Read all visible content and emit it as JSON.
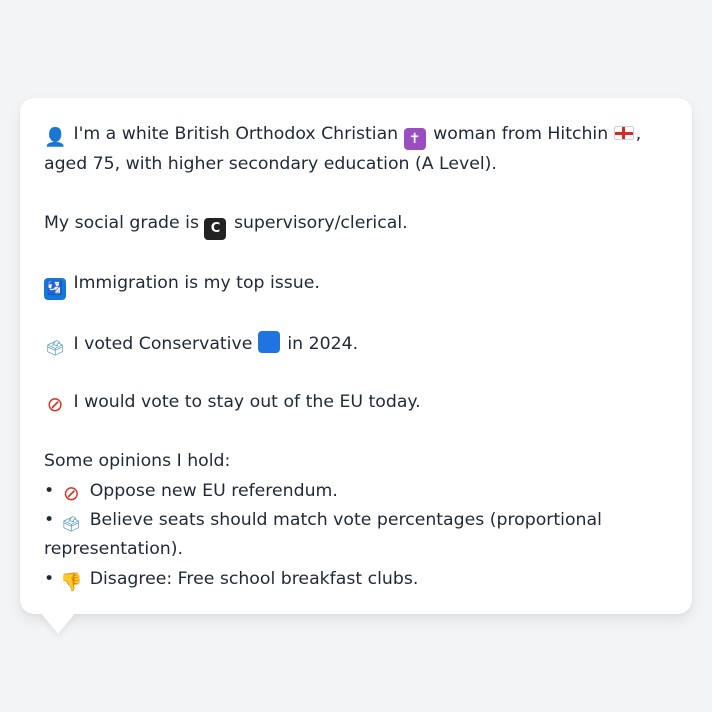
{
  "message": {
    "intro_a": "I'm a white British Orthodox Christian",
    "intro_b": "woman from Hitchin",
    "intro_c": ", aged 75, with higher secondary education (A Level).",
    "grade_a": "My social grade is",
    "grade_b": "supervisory/clerical.",
    "issue": "Immigration is my top issue.",
    "vote_a": "I voted Conservative",
    "vote_b": "in 2024.",
    "eu": "I would vote to stay out of the EU today.",
    "opinions_heading": "Some opinions I hold:",
    "bullet": "•",
    "opinions": [
      "Oppose new EU referendum.",
      "Believe seats should match vote percentages (proportional representation).",
      "Disagree: Free school breakfast clubs."
    ]
  },
  "icons": {
    "person": "👤",
    "cross": "✝",
    "c_letter": "C",
    "passport": "🛂",
    "ballot": "🗳",
    "no_entry": "⊘",
    "thumb": "👎"
  },
  "colors": {
    "background": "#f3f4f6",
    "bubble": "#ffffff",
    "conservative_blue": "#1f74e0",
    "flag_red": "#d52b1e"
  }
}
